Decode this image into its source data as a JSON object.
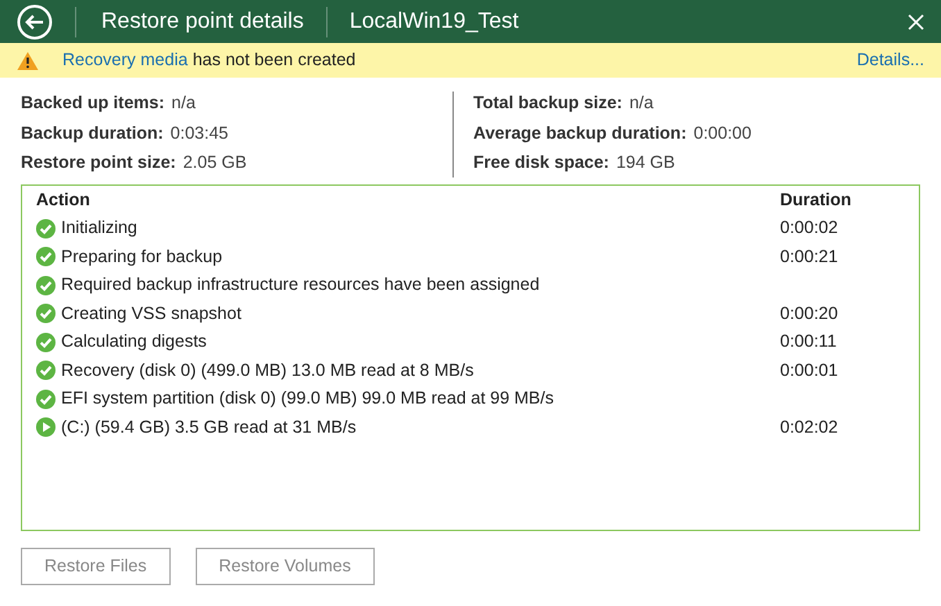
{
  "header": {
    "title": "Restore point details",
    "subtitle": "LocalWin19_Test"
  },
  "banner": {
    "link": "Recovery media",
    "message": "has not been created",
    "details": "Details..."
  },
  "summary_left": [
    {
      "label": "Backed up items:",
      "value": "n/a"
    },
    {
      "label": "Backup duration:",
      "value": "0:03:45"
    },
    {
      "label": "Restore point size:",
      "value": "2.05 GB"
    }
  ],
  "summary_right": [
    {
      "label": "Total backup size:",
      "value": "n/a"
    },
    {
      "label": "Average backup duration:",
      "value": "0:00:00"
    },
    {
      "label": "Free disk space:",
      "value": "194 GB"
    }
  ],
  "table": {
    "columns": [
      "Action",
      "Duration"
    ],
    "rows": [
      {
        "kind": "success",
        "action": "Initializing",
        "duration": "0:00:02"
      },
      {
        "kind": "success",
        "action": "Preparing for backup",
        "duration": "0:00:21"
      },
      {
        "kind": "success",
        "action": "Required backup infrastructure resources have been assigned"
      },
      {
        "kind": "success",
        "action": "Creating VSS snapshot",
        "duration": "0:00:20"
      },
      {
        "kind": "success",
        "action": "Calculating digests",
        "duration": "0:00:11"
      },
      {
        "kind": "success",
        "action": "Recovery (disk 0) (499.0 MB) 13.0 MB read at 8 MB/s",
        "duration": "0:00:01"
      },
      {
        "kind": "success",
        "action": "EFI system partition (disk 0) (99.0 MB) 99.0 MB read at 99 MB/s"
      },
      {
        "kind": "running",
        "action": "(C:) (59.4 GB) 3.5 GB read at 31 MB/s",
        "duration": "0:02:02"
      }
    ]
  },
  "buttons": [
    {
      "label": "Restore Files",
      "disabled": true
    },
    {
      "label": "Restore Volumes",
      "disabled": true
    }
  ]
}
